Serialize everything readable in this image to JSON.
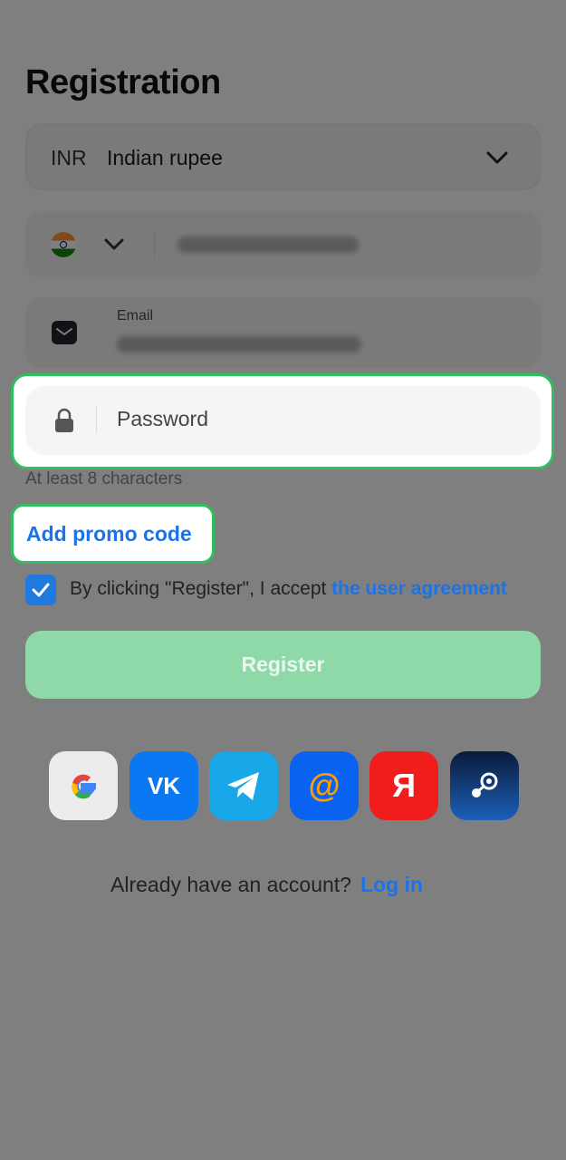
{
  "title": "Registration",
  "currency": {
    "code": "INR",
    "name": "Indian rupee"
  },
  "email": {
    "label": "Email"
  },
  "password": {
    "placeholder": "Password",
    "hint": "At least 8 characters"
  },
  "promo": {
    "label": "Add promo code"
  },
  "agreement": {
    "text": "By clicking \"Register\", I accept ",
    "link": "the user agreement",
    "checked": true
  },
  "register": {
    "label": "Register"
  },
  "social": {
    "icons": [
      "google-icon",
      "vk-icon",
      "telegram-icon",
      "mail-ru-icon",
      "yandex-icon",
      "steam-icon"
    ]
  },
  "footer": {
    "prompt": "Already have an account?",
    "login": "Log in"
  },
  "colors": {
    "accent": "#1a73e8",
    "highlight": "#2fbf5e",
    "register": "#8fd9a8"
  }
}
